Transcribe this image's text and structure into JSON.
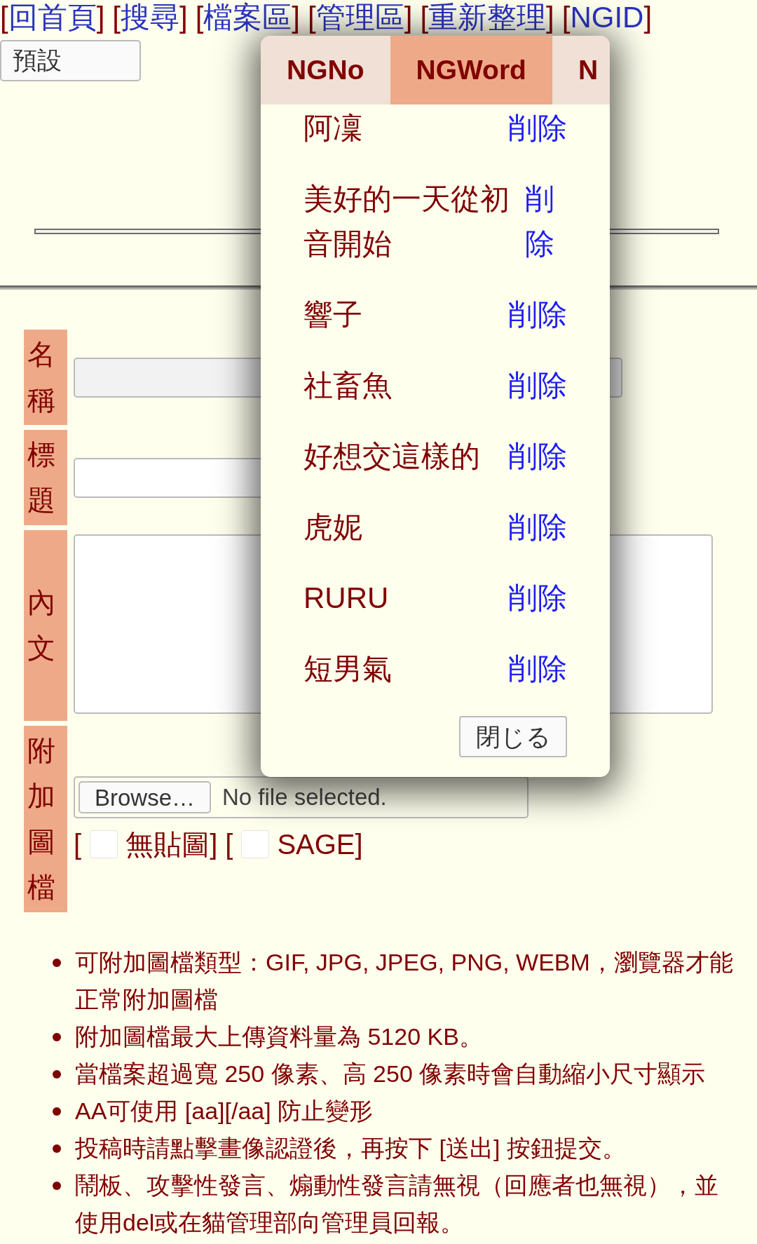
{
  "nav": [
    {
      "open": "[",
      "label": "回首頁",
      "close": "]"
    },
    {
      "open": "[",
      "label": "搜尋",
      "close": "]"
    },
    {
      "open": "[",
      "label": "檔案區",
      "close": "]"
    },
    {
      "open": "[",
      "label": "管理區",
      "close": "]"
    },
    {
      "open": "[",
      "label": "重新整理",
      "close": "]"
    },
    {
      "open": "[",
      "label": "NGID",
      "close": "]"
    }
  ],
  "style_select": {
    "value": "預設"
  },
  "form": {
    "rows": [
      {
        "kind": "text",
        "label": "名稱",
        "disabled": true
      },
      {
        "kind": "text",
        "label": "標題",
        "disabled": false
      },
      {
        "kind": "textarea",
        "label": "內文"
      },
      {
        "kind": "file",
        "label": "附加圖檔",
        "button": "Browse…",
        "status": "No file selected.",
        "options": [
          {
            "open": "[",
            "label": "無貼圖",
            "close": "]",
            "checked": false
          },
          {
            "open": "[",
            "label": "SAGE",
            "close": "]",
            "checked": false
          }
        ]
      }
    ]
  },
  "notes": [
    "可附加圖檔類型：GIF, JPG, JPEG, PNG, WEBM，瀏覽器才能正常附加圖檔",
    "附加圖檔最大上傳資料量為 5120 KB。",
    "當檔案超過寬 250 像素、高 250 像素時會自動縮小尺寸顯示",
    "AA可使用 [aa][/aa] 防止變形",
    "投稿時請點擊畫像認證後，再按下 [送出] 按鈕提交。",
    "鬧板、攻擊性發言、煽動性發言請無視（回應者也無視），並使用del或在貓管理部向管理員回報。"
  ],
  "ng_dialog": {
    "tabs": [
      {
        "label": "NGNo",
        "selected": false
      },
      {
        "label": "NGWord",
        "selected": true
      },
      {
        "label": "N",
        "selected": false
      }
    ],
    "entries": [
      {
        "word": "阿凜",
        "action": "削除"
      },
      {
        "word": "美好的一天從初音開始",
        "action": "削除"
      },
      {
        "word": "響子",
        "action": "削除"
      },
      {
        "word": "社畜魚",
        "action": "削除"
      },
      {
        "word": "好想交這樣的",
        "action": "削除"
      },
      {
        "word": "虎妮",
        "action": "削除"
      },
      {
        "word": "RURU",
        "action": "削除"
      },
      {
        "word": "短男氣",
        "action": "削除"
      }
    ],
    "close_button": "閉じる"
  }
}
